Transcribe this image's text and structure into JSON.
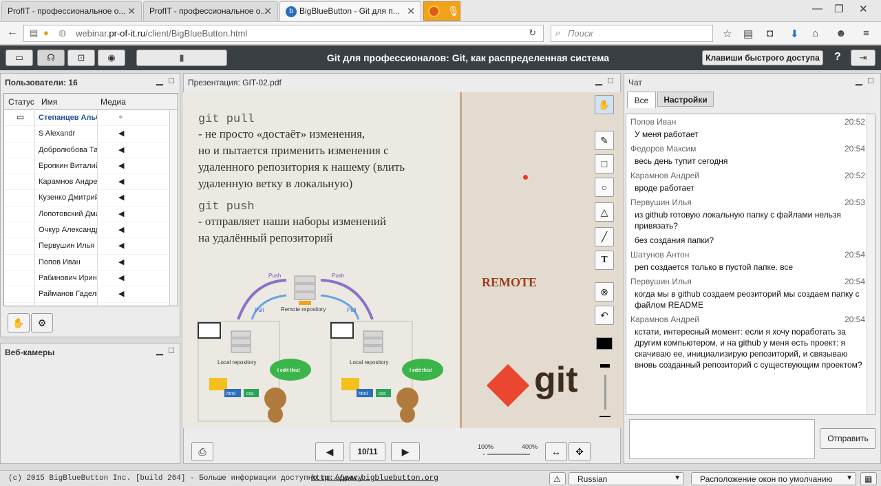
{
  "browser": {
    "tabs": [
      {
        "label": "ProfIT - профессиональное о..."
      },
      {
        "label": "ProfIT - профессиональное о..."
      },
      {
        "label": "BigBlueButton - Git для п..."
      }
    ],
    "url_prefix": "webinar.",
    "url_domain": "pr-of-it.ru",
    "url_path": "/client/BigBlueButton.html",
    "search_placeholder": "Поиск"
  },
  "app": {
    "title": "Git для профессионалов: Git, как распределенная система",
    "shortcuts_label": "Клавиши быстрого доступа",
    "help_label": "?"
  },
  "users": {
    "title": "Пользователи: 16",
    "columns": [
      "Статус",
      "Имя",
      "Медиа"
    ],
    "rows": [
      {
        "name": "Степанцев Альбер"
      },
      {
        "name": "S Alexandr"
      },
      {
        "name": "Добролюбова Татья"
      },
      {
        "name": "Еропкин Виталий"
      },
      {
        "name": "Карамнов Андрей"
      },
      {
        "name": "Кузенко Дмитрий"
      },
      {
        "name": "Лопотовский Дмитр"
      },
      {
        "name": "Очкур Александр"
      },
      {
        "name": "Первушин Илья"
      },
      {
        "name": "Попов Иван"
      },
      {
        "name": "Рабинович Ирина"
      },
      {
        "name": "Райманов Гадель"
      }
    ]
  },
  "webcams": {
    "title": "Веб-камеры"
  },
  "presentation": {
    "title": "Презентация: GIT-02.pdf",
    "slide": {
      "cmd1": "git pull",
      "text1": [
        "- не просто «достаёт» изменения,",
        "но и пытается применить изменения с",
        "удаленного репозитория к нашему (влить",
        "удаленную ветку в локальную)"
      ],
      "cmd2": "git push",
      "text2": [
        "- отправляет наши наборы изменений",
        "на удалённый репозиторий"
      ],
      "push": "Push",
      "pull": "Pull",
      "remote_repo": "Remote repository",
      "local_repo": "Local repository",
      "edit_badge": "I edit this!",
      "html": "html",
      "css": "css",
      "remote_label": "REMOTE",
      "git_logo": "git"
    },
    "page": "10/11",
    "zoom_min": "100%",
    "zoom_max": "400%"
  },
  "chat": {
    "title": "Чат",
    "tabs": [
      "Все",
      "Настройки"
    ],
    "messages": [
      {
        "who": "Попов Иван",
        "time": "20:52",
        "text": "У меня работает"
      },
      {
        "who": "Федоров Максим",
        "time": "20:54",
        "text": "весь день тупит сегодня"
      },
      {
        "who": "Карамнов Андрей",
        "time": "20:52",
        "text": "вроде работает"
      },
      {
        "who": "Первушин Илья",
        "time": "20:53",
        "text": "из github готовую локальную папку с файлами нельзя привязать?"
      },
      {
        "who": "",
        "time": "",
        "text": "без создания папки?"
      },
      {
        "who": "Шатунов Антон",
        "time": "20:54",
        "text": "реп создается только в пустой папке. все"
      },
      {
        "who": "Первушин Илья",
        "time": "20:54",
        "text": "когда мы в github создаем реозиторий мы создаем папку с файлом README"
      },
      {
        "who": "Карамнов Андрей",
        "time": "20:54",
        "text": "кстати, интересный момент: если я хочу поработать за другим компьютером, и на github у меня есть проект: я скачиваю ее, инициализирую репозиторий, и связываю вновь созданный репозиторий с существующим проектом?"
      }
    ],
    "send_label": "Отправить"
  },
  "footer": {
    "copyright": "(c) 2015 BigBlueButton Inc. [build 264] - Больше информации доступно по адресу",
    "link": "http://www.bigbluebutton.org",
    "language": "Russian",
    "layout": "Расположение окон по умолчанию"
  }
}
